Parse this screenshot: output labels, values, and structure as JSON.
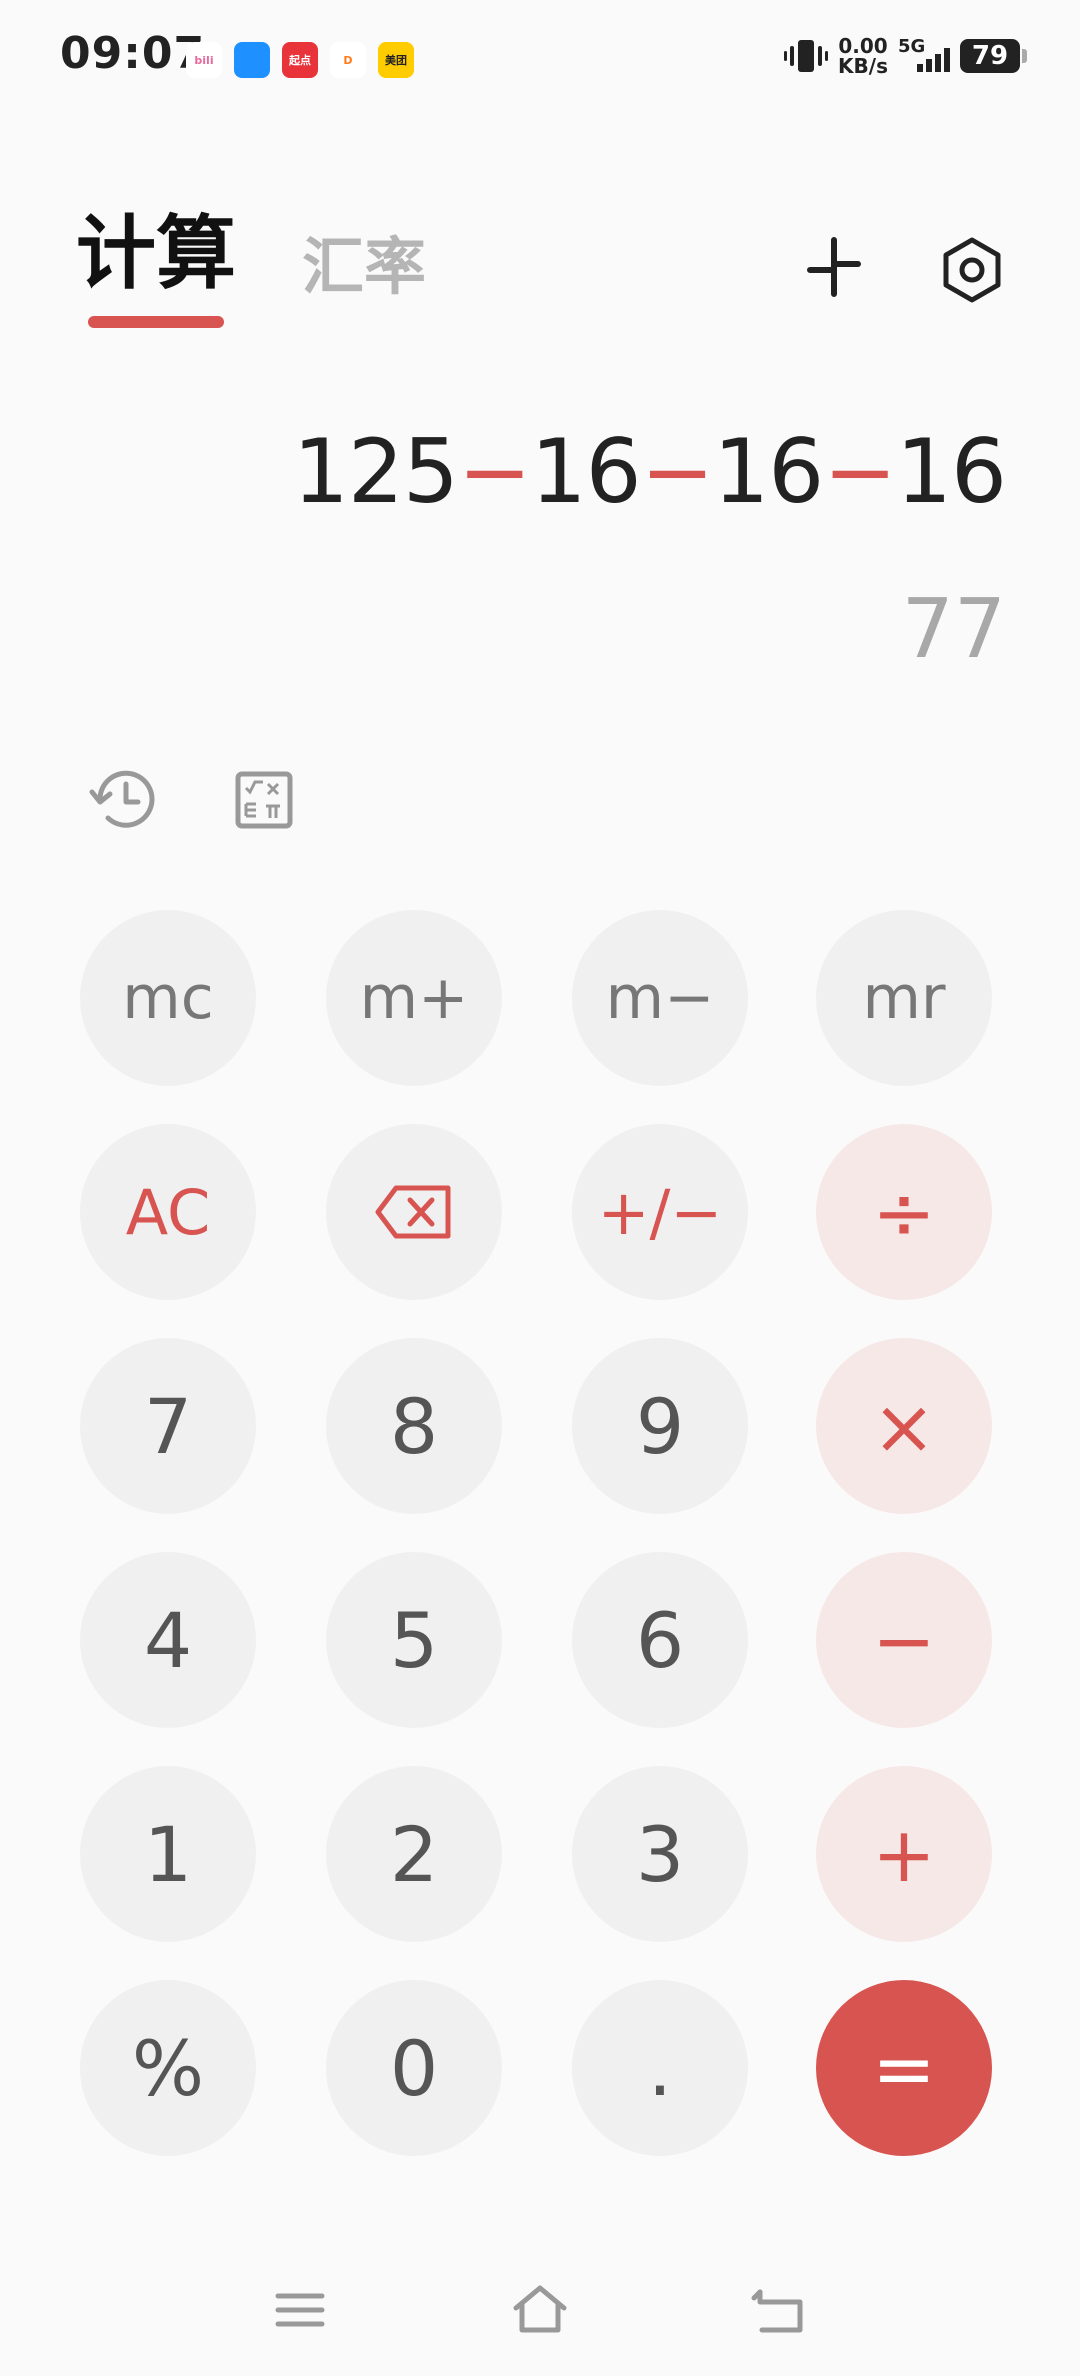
{
  "status_bar": {
    "time": "09:07",
    "notifications": [
      {
        "name": "bilibili-app-icon",
        "text": "bili",
        "color": "#ffffff",
        "fg": "#e66a9a"
      },
      {
        "name": "cloud-app-icon",
        "text": "",
        "color": "#1e90ff",
        "fg": "#ffffff"
      },
      {
        "name": "qidian-app-icon",
        "text": "起点",
        "color": "#e8333b",
        "fg": "#ffffff"
      },
      {
        "name": "didi-app-icon",
        "text": "D",
        "color": "#ffffff",
        "fg": "#ff7a1a"
      },
      {
        "name": "meituan-app-icon",
        "text": "美团",
        "color": "#ffcc00",
        "fg": "#222222"
      }
    ],
    "net_speed_value": "0.00",
    "net_speed_unit": "KB/s",
    "network": "5G",
    "battery": "79"
  },
  "header": {
    "tab_calc": "计算",
    "tab_rate": "汇率"
  },
  "display": {
    "tokens": [
      "125",
      "−",
      "16",
      "−",
      "16",
      "−",
      "16"
    ],
    "result": "77"
  },
  "keypad": [
    {
      "name": "mc-button",
      "label": "mc",
      "type": "mem"
    },
    {
      "name": "m-plus-button",
      "label": "m+",
      "type": "mem"
    },
    {
      "name": "m-minus-button",
      "label": "m−",
      "type": "mem"
    },
    {
      "name": "mr-button",
      "label": "mr",
      "type": "mem"
    },
    {
      "name": "all-clear-button",
      "label": "AC",
      "type": "fn"
    },
    {
      "name": "backspace-button",
      "label": "",
      "type": "fn",
      "icon": "backspace-icon"
    },
    {
      "name": "plus-minus-button",
      "label": "+/−",
      "type": "fn"
    },
    {
      "name": "divide-button",
      "label": "÷",
      "type": "op"
    },
    {
      "name": "digit-7-button",
      "label": "7",
      "type": "num"
    },
    {
      "name": "digit-8-button",
      "label": "8",
      "type": "num"
    },
    {
      "name": "digit-9-button",
      "label": "9",
      "type": "num"
    },
    {
      "name": "multiply-button",
      "label": "×",
      "type": "op"
    },
    {
      "name": "digit-4-button",
      "label": "4",
      "type": "num"
    },
    {
      "name": "digit-5-button",
      "label": "5",
      "type": "num"
    },
    {
      "name": "digit-6-button",
      "label": "6",
      "type": "num"
    },
    {
      "name": "minus-button",
      "label": "−",
      "type": "op"
    },
    {
      "name": "digit-1-button",
      "label": "1",
      "type": "num"
    },
    {
      "name": "digit-2-button",
      "label": "2",
      "type": "num"
    },
    {
      "name": "digit-3-button",
      "label": "3",
      "type": "num"
    },
    {
      "name": "plus-button",
      "label": "+",
      "type": "op"
    },
    {
      "name": "percent-button",
      "label": "%",
      "type": "num"
    },
    {
      "name": "digit-0-button",
      "label": "0",
      "type": "num"
    },
    {
      "name": "decimal-point-button",
      "label": ".",
      "type": "num"
    },
    {
      "name": "equals-button",
      "label": "=",
      "type": "eq"
    }
  ],
  "colors": {
    "accent": "#d85450",
    "operator_bg": "#f6e8e7",
    "key_bg": "#f0f0f0",
    "background": "#fafafa"
  }
}
